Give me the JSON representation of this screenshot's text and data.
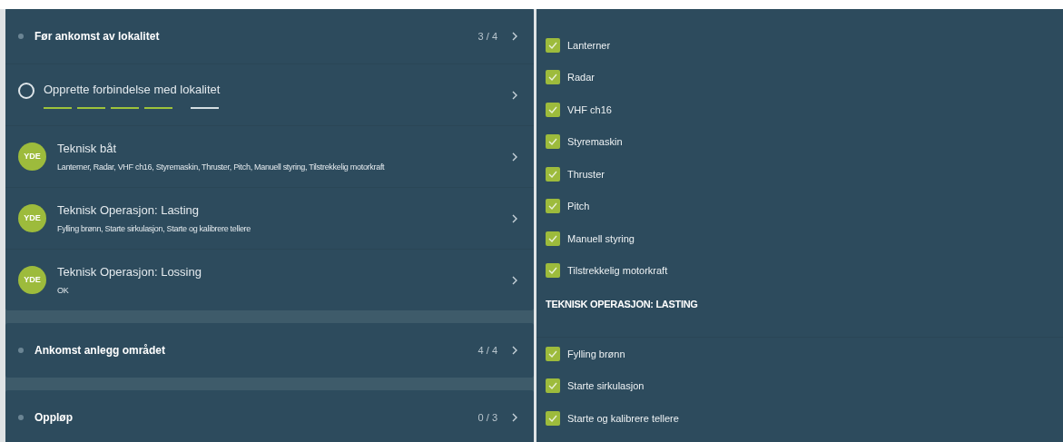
{
  "groups": [
    {
      "title": "Før ankomst av lokalitet",
      "count": "3 / 4",
      "tasks": [
        {
          "kind": "progress",
          "title": "Opprette forbindelse med lokalitet",
          "steps": [
            {
              "done": true
            },
            {
              "done": true
            },
            {
              "done": true
            },
            {
              "done": true
            },
            {
              "done": false
            }
          ]
        },
        {
          "kind": "badge",
          "badge": "YDE",
          "title": "Teknisk båt",
          "subtitle": "Lanterner, Radar, VHF ch16, Styremaskin, Thruster, Pitch, Manuell styring, Tilstrekkelig motorkraft"
        },
        {
          "kind": "badge",
          "badge": "YDE",
          "title": "Teknisk Operasjon: Lasting",
          "subtitle": "Fylling brønn, Starte sirkulasjon, Starte og kalibrere tellere"
        },
        {
          "kind": "badge",
          "badge": "YDE",
          "title": "Teknisk Operasjon: Lossing",
          "subtitle": "OK"
        }
      ]
    },
    {
      "title": "Ankomst anlegg området",
      "count": "4 / 4"
    },
    {
      "title": "Oppløp",
      "count": "0 / 3"
    }
  ],
  "checklist": [
    {
      "kind": "check",
      "label": "Lanterner",
      "checked": true
    },
    {
      "kind": "check",
      "label": "Radar",
      "checked": true
    },
    {
      "kind": "check",
      "label": "VHF ch16",
      "checked": true
    },
    {
      "kind": "check",
      "label": "Styremaskin",
      "checked": true
    },
    {
      "kind": "check",
      "label": "Thruster",
      "checked": true
    },
    {
      "kind": "check",
      "label": "Pitch",
      "checked": true
    },
    {
      "kind": "check",
      "label": "Manuell styring",
      "checked": true
    },
    {
      "kind": "check",
      "label": "Tilstrekkelig motorkraft",
      "checked": true
    },
    {
      "kind": "heading",
      "label": "TEKNISK OPERASJON: LASTING"
    },
    {
      "kind": "check",
      "label": "Fylling brønn",
      "checked": true
    },
    {
      "kind": "check",
      "label": "Starte sirkulasjon",
      "checked": true
    },
    {
      "kind": "check",
      "label": "Starte og kalibrere tellere",
      "checked": true
    }
  ]
}
